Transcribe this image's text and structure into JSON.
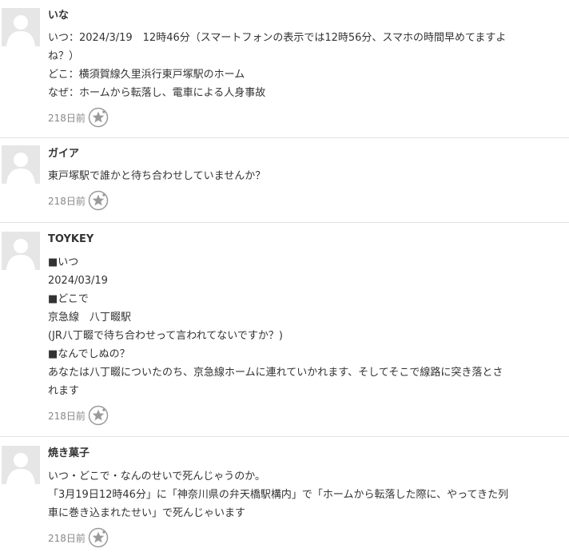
{
  "comments": [
    {
      "author": "いな",
      "lines": [
        "いつ：2024/3/19　12時46分（スマートフォンの表示では12時56分、スマホの時間早めてますよ",
        "ね？）",
        "どこ：横須賀線久里浜行東戸塚駅のホーム",
        "なぜ：ホームから転落し、電車による人身事故"
      ],
      "time": "218日前"
    },
    {
      "author": "ガイア",
      "lines": [
        "東戸塚駅で誰かと待ち合わせしていませんか？"
      ],
      "time": "218日前"
    },
    {
      "author": "TOYKEY",
      "lines": [
        "■いつ",
        "2024/03/19",
        "■どこで",
        "京急線　八丁畷駅",
        "(JR八丁畷で待ち合わせって言われてないですか？)",
        "■なんでしぬの？",
        "あなたは八丁畷についたのち、京急線ホームに連れていかれます、そしてそこで線路に突き落とさ",
        "れます"
      ],
      "time": "218日前"
    },
    {
      "author": "焼き菓子",
      "lines": [
        "いつ・どこで・なんのせいで死んじゃうのか。",
        "「3月19日12時46分」に「神奈川県の弁天橋駅構内」で「ホームから転落した際に、やってきた列",
        "車に巻き込まれたせい」で死んじゃいます"
      ],
      "time": "218日前"
    }
  ],
  "icons": {
    "avatar": "default-user-avatar-icon",
    "favorite": "star-plus-icon"
  },
  "colors": {
    "avatar_bg": "#e6e6e6",
    "avatar_fg": "#ffffff",
    "divider": "#e3e3e3",
    "text": "#333333",
    "muted": "#888888"
  }
}
